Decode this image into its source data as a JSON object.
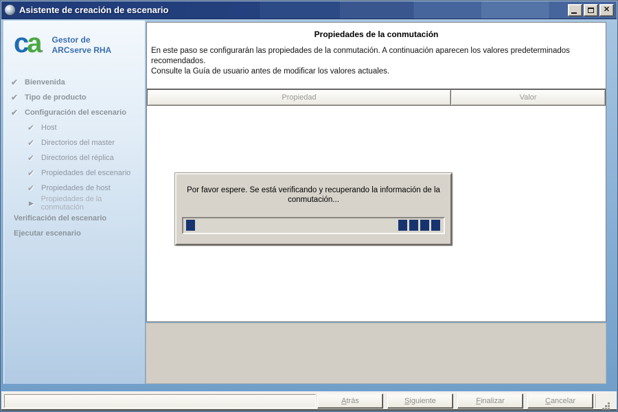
{
  "window": {
    "title": "Asistente de creación de escenario"
  },
  "icons": {
    "check": "✔",
    "arrow": "▶",
    "close": "✕"
  },
  "sidebar": {
    "logo": {
      "mark_c": "c",
      "mark_a": "a",
      "dot": ".",
      "line1": "Gestor de",
      "line2": "ARCserve RHA"
    },
    "items": [
      {
        "label": "Bienvenida",
        "level": 1,
        "state": "done"
      },
      {
        "label": "Tipo de producto",
        "level": 1,
        "state": "done"
      },
      {
        "label": "Configuración del escenario",
        "level": 1,
        "state": "done"
      },
      {
        "label": "Host",
        "level": 2,
        "state": "done"
      },
      {
        "label": "Directorios del master",
        "level": 2,
        "state": "done"
      },
      {
        "label": "Directorios del réplica",
        "level": 2,
        "state": "done"
      },
      {
        "label": "Propiedades del escenario",
        "level": 2,
        "state": "done"
      },
      {
        "label": "Propiedades de host",
        "level": 2,
        "state": "done"
      },
      {
        "label": "Propiedades de la conmutación",
        "level": 2,
        "state": "current"
      },
      {
        "label": "Verificación del escenario",
        "level": 1,
        "state": "pending"
      },
      {
        "label": "Ejecutar escenario",
        "level": 1,
        "state": "pending"
      }
    ]
  },
  "main": {
    "title": "Propiedades de la conmutación",
    "description": [
      "En este paso se configurarán las propiedades de la conmutación. A continuación aparecen los valores predeterminados recomendados.",
      "Consulte la Guía de usuario antes de modificar los valores actuales."
    ],
    "table": {
      "columns": [
        "Propiedad",
        "Valor"
      ],
      "rows": []
    },
    "progress_dialog": {
      "message": "Por favor espere. Se está verificando y recuperando la información de la conmutación...",
      "style": "marquee"
    }
  },
  "footer": {
    "buttons": [
      {
        "label": "Atrás",
        "mnemonic": "A",
        "rest": "trás",
        "enabled": false
      },
      {
        "label": "Siguiente",
        "mnemonic": "S",
        "rest": "iguiente",
        "enabled": false
      },
      {
        "label": "Finalizar",
        "mnemonic": "F",
        "rest": "inalizar",
        "enabled": false
      },
      {
        "label": "Cancelar",
        "mnemonic": "C",
        "rest": "ancelar",
        "enabled": false
      }
    ]
  },
  "colors": {
    "titlebar": "#24417e",
    "progress_block": "#17336f",
    "logo_blue": "#1f6cb4",
    "logo_green": "#49a942",
    "brand_text_blue": "#3a6fae",
    "sidebar_text": "#8d949b",
    "disabled_button_text": "#8e8e8e"
  }
}
